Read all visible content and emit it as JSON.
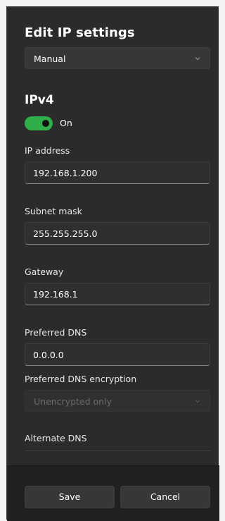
{
  "dialog": {
    "title": "Edit IP settings",
    "mode_select": {
      "value": "Manual",
      "icon": "chevron-down-icon"
    },
    "ipv4": {
      "heading": "IPv4",
      "toggle": {
        "state": "on",
        "label": "On",
        "color": "#2fae4a"
      },
      "fields": {
        "ip_address": {
          "label": "IP address",
          "value": "192.168.1.200"
        },
        "subnet_mask": {
          "label": "Subnet mask",
          "value": "255.255.255.0"
        },
        "gateway": {
          "label": "Gateway",
          "value": "192.168.1"
        },
        "preferred_dns": {
          "label": "Preferred DNS",
          "value": "0.0.0.0"
        },
        "preferred_dns_encryption": {
          "label": "Preferred DNS encryption",
          "value": "Unencrypted only",
          "disabled": true
        },
        "alternate_dns": {
          "label": "Alternate DNS",
          "value": ""
        }
      }
    },
    "buttons": {
      "save": "Save",
      "cancel": "Cancel"
    }
  }
}
